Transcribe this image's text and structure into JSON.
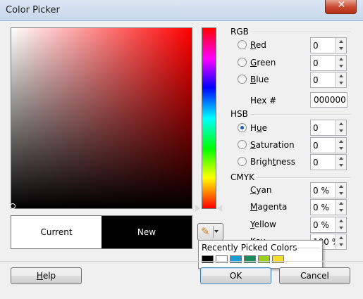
{
  "window": {
    "title": "Color Picker",
    "close_glyph": "✕"
  },
  "preview": {
    "current_label": "Current",
    "new_label": "New",
    "current_color": "#ffffff",
    "new_color": "#000000"
  },
  "rgb": {
    "group_label": "RGB",
    "red": {
      "label_key": "R",
      "label_rest": "ed",
      "value": "0"
    },
    "green": {
      "label_key": "G",
      "label_rest": "reen",
      "value": "0"
    },
    "blue": {
      "label_key": "B",
      "label_rest": "lue",
      "value": "0"
    },
    "hex_label": "Hex #",
    "hex_value": "000000"
  },
  "hsb": {
    "group_label": "HSB",
    "hue": {
      "label_key": "u",
      "label_pre": "H",
      "label_rest": "e",
      "value": "0",
      "selected": true
    },
    "saturation": {
      "label_key": "S",
      "label_rest": "aturation",
      "value": "0"
    },
    "brightness": {
      "label_pre": "Brigh",
      "label_key": "t",
      "label_rest": "ness",
      "value": "0"
    }
  },
  "cmyk": {
    "group_label": "CMYK",
    "cyan": {
      "label_key": "C",
      "label_rest": "yan",
      "value": "0 %"
    },
    "magenta": {
      "label_key": "M",
      "label_rest": "agenta",
      "value": "0 %"
    },
    "yellow": {
      "label_key": "Y",
      "label_rest": "ellow",
      "value": "0 %"
    },
    "key": {
      "label_key": "K",
      "label_rest": "ey",
      "value": "100 %"
    }
  },
  "eyedropper": {
    "icon": "pipette-icon"
  },
  "recent_popup": {
    "title": "Recently Picked Colors",
    "swatches": [
      "#000000",
      "#ffffff",
      "#1a9cd8",
      "#1a8a5a",
      "#9ccf1b",
      "#f5dc2a"
    ]
  },
  "buttons": {
    "help_key": "H",
    "help_rest": "elp",
    "ok": "OK",
    "cancel": "Cancel"
  }
}
